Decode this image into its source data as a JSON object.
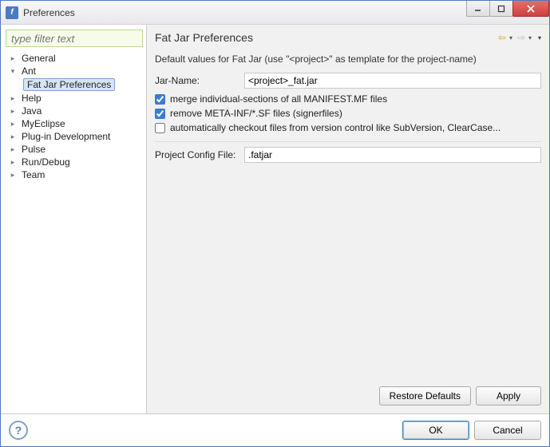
{
  "window": {
    "title": "Preferences"
  },
  "filter": {
    "placeholder": "type filter text"
  },
  "tree": {
    "items": [
      {
        "label": "General",
        "expandable": true
      },
      {
        "label": "Ant",
        "expandable": true,
        "expanded": true,
        "children": [
          {
            "label": "Fat Jar Preferences",
            "selected": true
          }
        ]
      },
      {
        "label": "Help",
        "expandable": true
      },
      {
        "label": "Java",
        "expandable": true
      },
      {
        "label": "MyEclipse",
        "expandable": true
      },
      {
        "label": "Plug-in Development",
        "expandable": true
      },
      {
        "label": "Pulse",
        "expandable": true
      },
      {
        "label": "Run/Debug",
        "expandable": true
      },
      {
        "label": "Team",
        "expandable": true
      }
    ]
  },
  "panel": {
    "title": "Fat Jar Preferences",
    "description": "Default values for Fat Jar (use \"<project>\" as template for the project-name)",
    "jarName": {
      "label": "Jar-Name:",
      "value": "<project>_fat.jar"
    },
    "checks": {
      "merge": {
        "label": "merge individual-sections of all MANIFEST.MF files",
        "checked": true
      },
      "removeSF": {
        "label": "remove META-INF/*.SF files (signerfiles)",
        "checked": true
      },
      "autoCheckout": {
        "label": "automatically checkout files from version control like SubVersion, ClearCase...",
        "checked": false
      }
    },
    "configFile": {
      "label": "Project Config File:",
      "value": ".fatjar"
    },
    "buttons": {
      "restore": "Restore Defaults",
      "apply": "Apply"
    }
  },
  "footer": {
    "ok": "OK",
    "cancel": "Cancel"
  }
}
